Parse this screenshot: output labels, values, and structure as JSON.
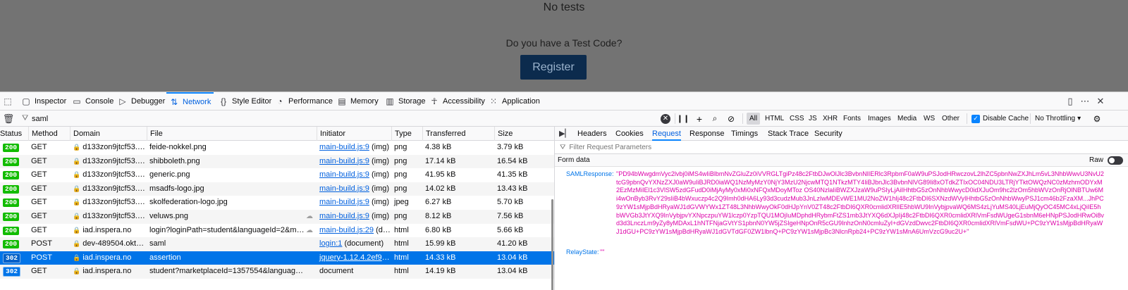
{
  "page": {
    "no_tests": "No tests",
    "question": "Do you have a Test Code?",
    "register_label": "Register"
  },
  "devtools": {
    "tabs": [
      "Inspector",
      "Console",
      "Debugger",
      "Network",
      "Style Editor",
      "Performance",
      "Memory",
      "Storage",
      "Accessibility",
      "Application"
    ],
    "selected_tab": "Network",
    "toolbar": {
      "filter_value": "saml",
      "filter_placeholder": "Filter URLs",
      "type_filters": [
        "All",
        "HTML",
        "CSS",
        "JS",
        "XHR",
        "Fonts",
        "Images",
        "Media",
        "WS",
        "Other"
      ],
      "disable_cache_label": "Disable Cache",
      "throttling_label": "No Throttling"
    },
    "columns": [
      "Status",
      "Method",
      "Domain",
      "File",
      "Initiator",
      "Type",
      "Transferred",
      "Size"
    ],
    "rows": [
      {
        "status": "200",
        "method": "GET",
        "domain": "d133zon9jtcf53.clo...",
        "file": "feide-nokkel.png",
        "initiator": "main-build.js:9",
        "initiator_suffix": " (img)",
        "type": "png",
        "transferred": "4.38 kB",
        "size": "3.79 kB",
        "secure": true
      },
      {
        "status": "200",
        "method": "GET",
        "domain": "d133zon9jtcf53.clo...",
        "file": "shibboleth.png",
        "initiator": "main-build.js:9",
        "initiator_suffix": " (img)",
        "type": "png",
        "transferred": "17.14 kB",
        "size": "16.54 kB",
        "secure": true
      },
      {
        "status": "200",
        "method": "GET",
        "domain": "d133zon9jtcf53.clo...",
        "file": "generic.png",
        "initiator": "main-build.js:9",
        "initiator_suffix": " (img)",
        "type": "png",
        "transferred": "41.95 kB",
        "size": "41.35 kB",
        "secure": true
      },
      {
        "status": "200",
        "method": "GET",
        "domain": "d133zon9jtcf53.clo...",
        "file": "msadfs-logo.jpg",
        "initiator": "main-build.js:9",
        "initiator_suffix": " (img)",
        "type": "png",
        "transferred": "14.02 kB",
        "size": "13.43 kB",
        "secure": true
      },
      {
        "status": "200",
        "method": "GET",
        "domain": "d133zon9jtcf53.clo...",
        "file": "skolfederation-logo.jpg",
        "initiator": "main-build.js:9",
        "initiator_suffix": " (img)",
        "type": "jpeg",
        "transferred": "6.27 kB",
        "size": "5.70 kB",
        "secure": true
      },
      {
        "status": "200",
        "method": "GET",
        "domain": "d133zon9jtcf53.clo...",
        "file": "veluws.png",
        "initiator": "main-build.js:9",
        "initiator_suffix": " (img)",
        "type": "png",
        "transferred": "8.12 kB",
        "size": "7.56 kB",
        "secure": true
      },
      {
        "status": "200",
        "method": "GET",
        "domain": "iad.inspera.no",
        "file": "login?loginPath=student&languageId=2&marketpl",
        "initiator": "main-build.js:29",
        "initiator_suffix": " (doc...",
        "type": "html",
        "transferred": "6.80 kB",
        "size": "5.66 kB",
        "secure": true
      },
      {
        "status": "200",
        "method": "POST",
        "domain": "dev-489504.okta.com",
        "file": "saml",
        "initiator": "login:1",
        "initiator_suffix": " (document)",
        "type": "html",
        "transferred": "15.99 kB",
        "size": "41.20 kB",
        "secure": true
      },
      {
        "status": "302",
        "method": "POST",
        "domain": "iad.inspera.no",
        "file": "assertion",
        "initiator": "jquery-1.12.4.2ef93d9...",
        "initiator_suffix": "",
        "type": "html",
        "transferred": "14.33 kB",
        "size": "13.04 kB",
        "secure": true,
        "selected": true
      },
      {
        "status": "302",
        "method": "GET",
        "domain": "iad.inspera.no",
        "file": "student?marketplaceId=1357554&languageId=2&ssoUs",
        "initiator": "",
        "initiator_suffix": "document",
        "type": "html",
        "transferred": "14.19 kB",
        "size": "13.04 kB",
        "secure": true
      }
    ],
    "sidebar": {
      "tabs": [
        "Headers",
        "Cookies",
        "Request",
        "Response",
        "Timings",
        "Stack Trace",
        "Security"
      ],
      "selected_tab": "Request",
      "filter_placeholder": "Filter Request Parameters",
      "form_data_label": "Form data",
      "raw_label": "Raw",
      "params": [
        {
          "key": "SAMLResponse:",
          "value": "\"PD94bWwgdmVyc2lvbj0iMS4wIiBlbmNvZGluZz0iVVRGLTgiPz48c2FtbDJwOlJlc3BvbnNlIERlc3RpbmF0aW9uPSJodHRwczovL2lhZC5pbnNwZXJhLm5vL3NhbWwvU3NvU2tcG9pbnQvYXNzZXJ0aW9uIiBJRD0iaWQ1NzMyMzY0NjY3MzU2NjcwMTQ1NTkzMTY4IiBJbnJlc3BvbnNlVG89Ii8xOTdkZTIxOC04NDU3LTRjYTktOWQzNC0zMzhmODYxM2EzMzMiIEl1c3VlSW5zdGFudD0iMjAyMy0xMi0xNFQxMDoyMToz OS40NzlaIiBWZXJzaW9uPSIyLjAiIHhtbG5zOnNhbWwycD0idXJuOm9hc2lzOm5hbWVzOnRjOlNBTUw6Mi4wOnByb3RvY29sIiB4bWxuczp4c2Q9Imh0dHA6Ly93d3cudzMub3JnLzIwMDEvWE1MU2NoZW1hIj48c2FtbDI6SXNzdWVyIHhtbG5zOnNhbWwyPSJ1cm46b2FzaXM...JhPC9zYW1sMjpBdHRyaWJ1dGVWYWx1ZT48L3NhbWwyOkF0dHJpYnV0ZT48c2FtbDI6QXR0cmlidXRlIE5hbWU9InVybjpvaWQ6MS4zLjYuMS40LjEuMjQyOC45MC4xLjQiIE5hbWVGb3JtYXQ9InVybjpvYXNpczpuYW1lczp0YzpTQU1MOjIuMDphdHRybmFtZS1mb3JtYXQ6dXJpIj48c2FtbDI6QXR0cmlidXRlVmFsdWUgeG1sbnM6eHNpPSJodHRwOi8vd3d3LnczLm9yZy8yMDAxL1hNTFNjaGVtYS1pbnN0YW5jZSIgeHNpOnR5cGU9InhzOnN0cmluZyI+dGVzdDwvc2FtbDI6QXR0cmlidXRlVmFsdWU+PC9zYW1sMjpBdHRyaWJ1dGU+PC9zYW1sMjpBdHRyaWJ1dGVTdGF0ZW1lbnQ+PC9zYW1sMjpBc3NlcnRpb24+PC9zYW1sMnA6UmVzcG9uc2U+\""
        },
        {
          "key": "RelayState:",
          "value": "\"\""
        }
      ]
    }
  }
}
